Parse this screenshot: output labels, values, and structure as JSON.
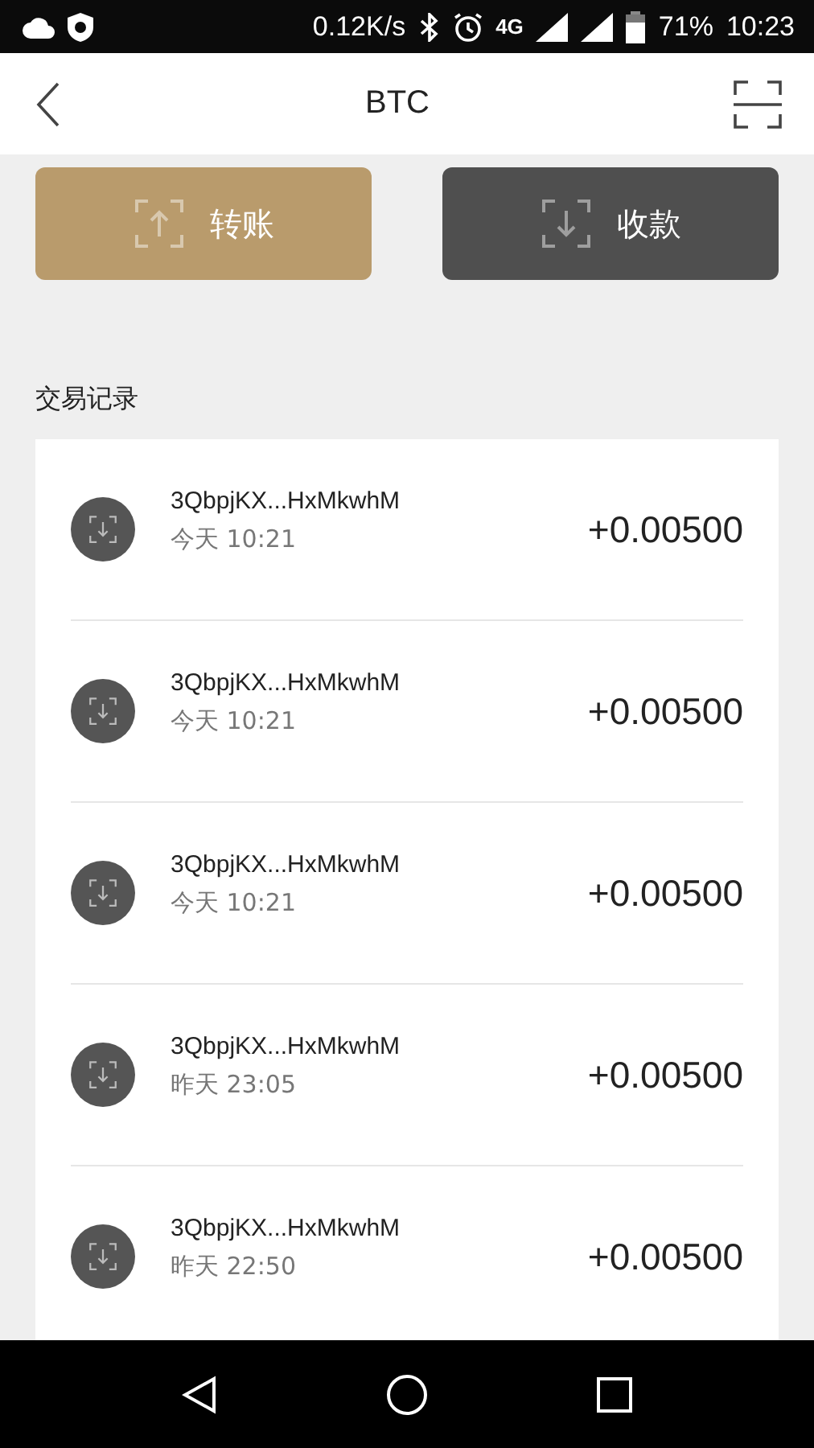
{
  "status_bar": {
    "speed": "0.12K/s",
    "network": "4G",
    "battery": "71%",
    "time": "10:23"
  },
  "header": {
    "title": "BTC"
  },
  "actions": [
    {
      "kind": "send",
      "label": "转账"
    },
    {
      "kind": "receive",
      "label": "收款"
    }
  ],
  "section_title": "交易记录",
  "transactions": [
    {
      "address": "3QbpjKX...HxMkwhM",
      "time": "今天 10:21",
      "amount": "+0.00500"
    },
    {
      "address": "3QbpjKX...HxMkwhM",
      "time": "今天 10:21",
      "amount": "+0.00500"
    },
    {
      "address": "3QbpjKX...HxMkwhM",
      "time": "今天 10:21",
      "amount": "+0.00500"
    },
    {
      "address": "3QbpjKX...HxMkwhM",
      "time": "昨天 23:05",
      "amount": "+0.00500"
    },
    {
      "address": "3QbpjKX...HxMkwhM",
      "time": "昨天 22:50",
      "amount": "+0.00500"
    }
  ]
}
